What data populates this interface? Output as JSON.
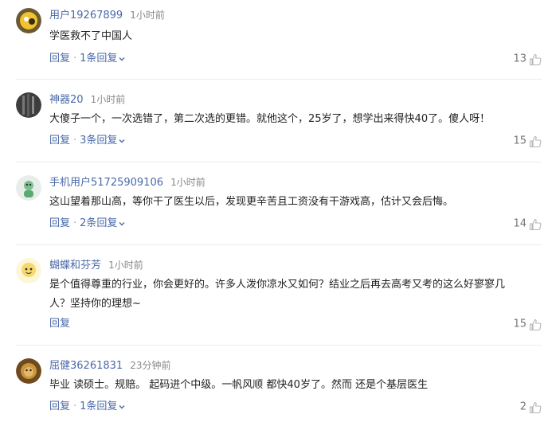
{
  "comments": [
    {
      "avatar": "avatar-yellow-circle",
      "username": "用户19267899",
      "time": "1小时前",
      "lines": [
        "学医救不了中国人"
      ],
      "reply_label": "回复",
      "replies_label": "1条回复",
      "likes": "13"
    },
    {
      "avatar": "avatar-dark-gray",
      "username": "神器20",
      "time": "1小时前",
      "lines": [
        "大傻子一个，一次选错了，第二次选的更错。就他这个，25岁了，想学出来得快40了。傻人呀！"
      ],
      "reply_label": "回复",
      "replies_label": "3条回复",
      "likes": "15"
    },
    {
      "avatar": "avatar-green-figure",
      "username": "手机用户51725909106",
      "time": "1小时前",
      "lines": [
        "这山望着那山高，等你干了医生以后，发现更辛苦且工资没有干游戏高，估计又会后悔。"
      ],
      "reply_label": "回复",
      "replies_label": "2条回复",
      "likes": "14"
    },
    {
      "avatar": "avatar-cartoon-face",
      "username": "蝴蝶和芬芳",
      "time": "1小时前",
      "lines": [
        "是个值得尊重的行业，你会更好的。许多人泼你凉水又如何？结业之后再去高考又考的这么好寥寥几",
        "人？坚持你的理想~"
      ],
      "reply_label": "回复",
      "replies_label": "",
      "likes": "15"
    },
    {
      "avatar": "avatar-lion",
      "username": "屈健36261831",
      "time": "23分钟前",
      "lines": [
        "毕业 读硕士。规赔。 起码进个中级。一帆风顺 都快40岁了。然而 还是个基层医生"
      ],
      "reply_label": "回复",
      "replies_label": "1条回复",
      "likes": "2"
    }
  ],
  "colors": {
    "link": "#4a69a8",
    "text": "#222222",
    "muted": "#888888",
    "divider": "#ececec"
  },
  "icons": {
    "like": "thumbs-up-icon",
    "expand": "chevron-down-icon"
  }
}
